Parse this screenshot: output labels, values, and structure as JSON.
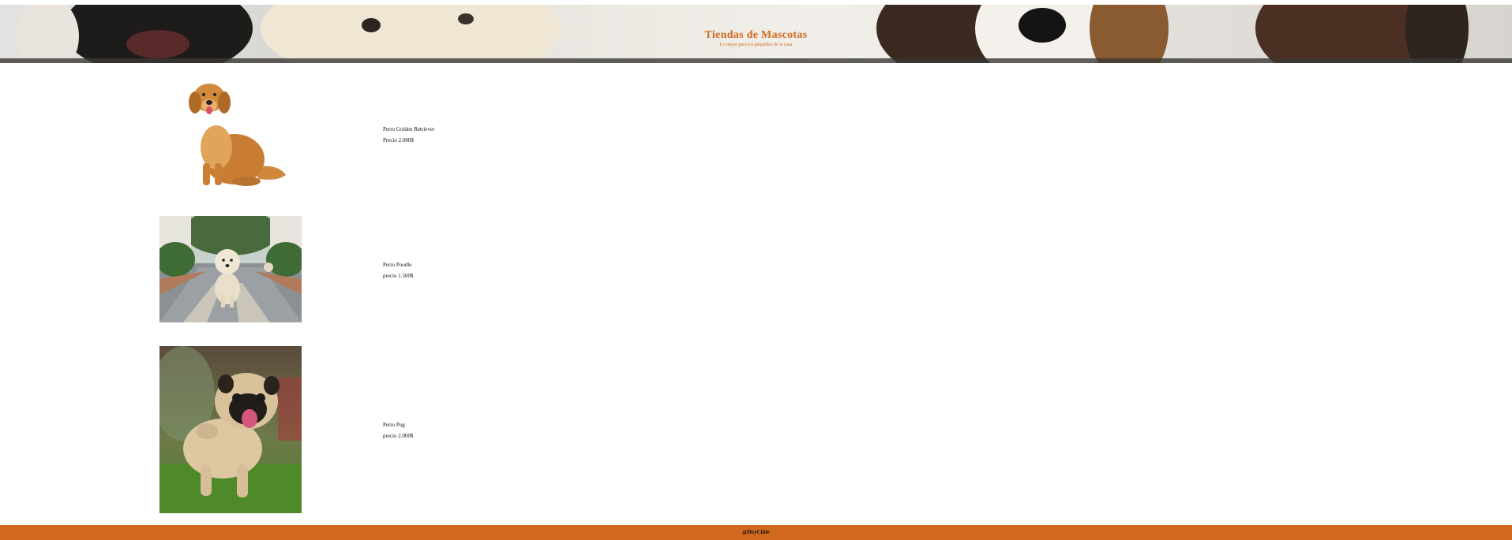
{
  "header": {
    "title": "Tiendas de Mascotas",
    "subtitle": "Lo mejor para los pequeños de la casa",
    "banner_image": "dogs-banner-photo"
  },
  "products": [
    {
      "image": "golden-retriever-photo",
      "name": "Perro Golden Retriever",
      "price": "Precio 2.000$"
    },
    {
      "image": "poodle-photo",
      "name": "Perro Poodle",
      "price": "precio 1.500$"
    },
    {
      "image": "pug-photo",
      "name": "Perro Pug",
      "price": "precio 2.000$"
    }
  ],
  "footer": {
    "text": "@DeyChile"
  },
  "colors": {
    "accent": "#d2691e",
    "background": "#ffffff"
  }
}
